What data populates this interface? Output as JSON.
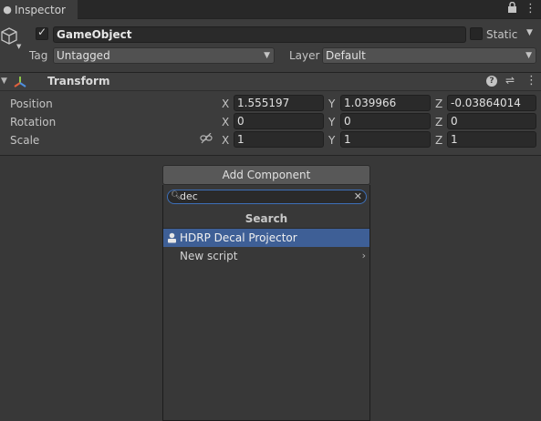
{
  "tabbar": {
    "tab_label": "Inspector",
    "tab_icon": "info-icon",
    "lock_icon": "lock-icon",
    "menu_icon": "kebab-menu-icon"
  },
  "header": {
    "object_icon": "cube-icon",
    "active": true,
    "name": "GameObject",
    "static_label": "Static",
    "static_checked": false,
    "tag_label": "Tag",
    "tag_value": "Untagged",
    "layer_label": "Layer",
    "layer_value": "Default"
  },
  "transform": {
    "title": "Transform",
    "icon": "transform-icon",
    "rows": [
      {
        "label": "Position",
        "x": "1.555197",
        "y": "1.039966",
        "z": "-0.03864014"
      },
      {
        "label": "Rotation",
        "x": "0",
        "y": "0",
        "z": "0"
      },
      {
        "label": "Scale",
        "x": "1",
        "y": "1",
        "z": "1"
      }
    ],
    "axis_labels": {
      "x": "X",
      "y": "Y",
      "z": "Z"
    }
  },
  "add_component": {
    "button_label": "Add Component",
    "search_value": "dec",
    "popup_title": "Search",
    "items": [
      {
        "label": "HDRP Decal Projector",
        "icon": "component-icon",
        "selected": true
      },
      {
        "label": "New script",
        "icon": "",
        "submenu": true
      }
    ]
  },
  "colors": {
    "accent": "#3e5f96",
    "panel": "#3c3c3c",
    "field": "#2a2a2a"
  }
}
